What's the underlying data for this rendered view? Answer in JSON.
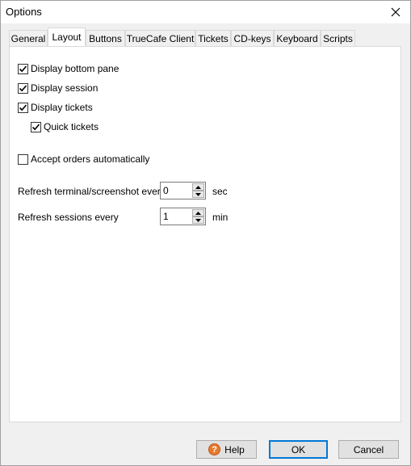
{
  "window": {
    "title": "Options",
    "close_glyph": "×"
  },
  "tabs": [
    {
      "label": "General",
      "active": false
    },
    {
      "label": "Layout",
      "active": true
    },
    {
      "label": "Buttons",
      "active": false
    },
    {
      "label": "TrueCafe Client",
      "active": false
    },
    {
      "label": "Tickets",
      "active": false
    },
    {
      "label": "CD-keys",
      "active": false
    },
    {
      "label": "Keyboard",
      "active": false
    },
    {
      "label": "Scripts",
      "active": false
    }
  ],
  "layout": {
    "checkboxes": [
      {
        "label": "Display bottom pane",
        "checked": true
      },
      {
        "label": "Display session",
        "checked": true
      },
      {
        "label": "Display tickets",
        "checked": true
      },
      {
        "label": "Quick tickets",
        "checked": true
      },
      {
        "label": "Accept orders automatically",
        "checked": false
      }
    ],
    "refresh_terminal": {
      "label": "Refresh terminal/screenshot every",
      "value": "0",
      "unit": "sec"
    },
    "refresh_sessions": {
      "label": "Refresh sessions every",
      "value": "1",
      "unit": "min"
    }
  },
  "buttons": {
    "help": "Help",
    "ok": "OK",
    "cancel": "Cancel",
    "help_icon_glyph": "?"
  }
}
